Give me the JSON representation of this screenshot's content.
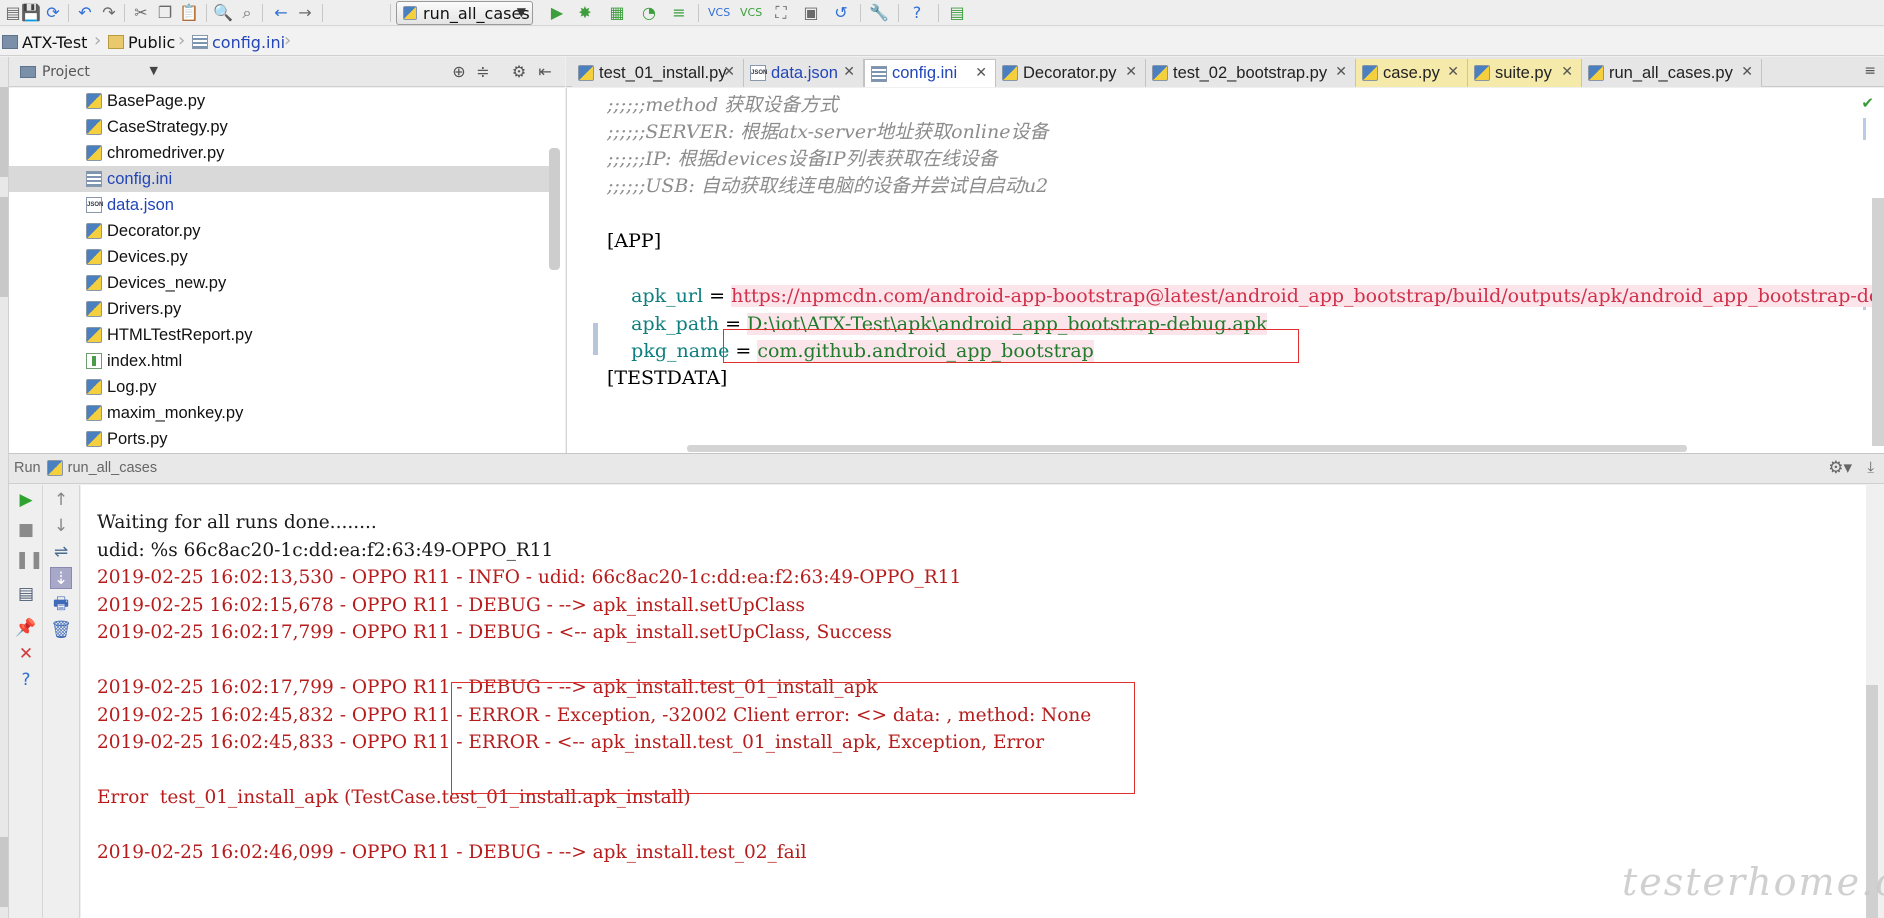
{
  "toolbar": {
    "run_config": "run_all_cases"
  },
  "breadcrumb": {
    "items": [
      "ATX-Test",
      "Public",
      "config.ini"
    ]
  },
  "project": {
    "selector_label": "Project",
    "files": [
      {
        "name": "BasePage.py",
        "type": "py"
      },
      {
        "name": "CaseStrategy.py",
        "type": "py"
      },
      {
        "name": "chromedriver.py",
        "type": "py"
      },
      {
        "name": "config.ini",
        "type": "ini",
        "selected": true
      },
      {
        "name": "data.json",
        "type": "json"
      },
      {
        "name": "Decorator.py",
        "type": "py"
      },
      {
        "name": "Devices.py",
        "type": "py"
      },
      {
        "name": "Devices_new.py",
        "type": "py"
      },
      {
        "name": "Drivers.py",
        "type": "py"
      },
      {
        "name": "HTMLTestReport.py",
        "type": "py"
      },
      {
        "name": "index.html",
        "type": "html"
      },
      {
        "name": "Log.py",
        "type": "py"
      },
      {
        "name": "maxim_monkey.py",
        "type": "py"
      },
      {
        "name": "Ports.py",
        "type": "py"
      }
    ]
  },
  "editor": {
    "tabs": [
      {
        "label": "test_01_install.py"
      },
      {
        "label": "data.json"
      },
      {
        "label": "config.ini"
      },
      {
        "label": "Decorator.py"
      },
      {
        "label": "test_02_bootstrap.py"
      },
      {
        "label": "case.py"
      },
      {
        "label": "suite.py"
      },
      {
        "label": "run_all_cases.py"
      }
    ],
    "lines": [
      {
        "comment": ";;;;;;method 获取设备方式"
      },
      {
        "comment": ";;;;;;SERVER: 根据atx-server地址获取online设备"
      },
      {
        "comment": ";;;;;;IP: 根据devices设备IP列表获取在线设备"
      },
      {
        "comment": ";;;;;;USB: 自动获取线连电脑的设备并尝试自启动u2"
      },
      {
        "comment": ""
      },
      {
        "section": "[APP]"
      },
      {
        "key": "apk_url",
        "eq": " = ",
        "value": "https://npmcdn.com/android-app-bootstrap@latest/android_app_bootstrap/build/outputs/apk/android_app_bootstrap-debug.apk"
      },
      {
        "key": "apk_path",
        "eq": " = ",
        "value": "D:\\iot\\ATX-Test\\apk\\android_app_bootstrap-debug.apk"
      },
      {
        "key": "pkg_name",
        "eq": " = ",
        "value": "com.github.android_app_bootstrap"
      },
      {
        "comment": ""
      },
      {
        "section": "[TESTDATA]"
      }
    ]
  },
  "run": {
    "title_prefix": "Run",
    "config_name": "run_all_cases",
    "console_lines": [
      {
        "text": "Waiting for all runs done........",
        "kind": "plain"
      },
      {
        "text": "udid: %s 66c8ac20-1c:dd:ea:f2:63:49-OPPO_R11",
        "kind": "plain"
      },
      {
        "text": "2019-02-25 16:02:13,530 - OPPO R11 - INFO - udid: 66c8ac20-1c:dd:ea:f2:63:49-OPPO_R11",
        "kind": "err"
      },
      {
        "text": "2019-02-25 16:02:15,678 - OPPO R11 - DEBUG - --> apk_install.setUpClass",
        "kind": "err"
      },
      {
        "text": "2019-02-25 16:02:17,799 - OPPO R11 - DEBUG - <-- apk_install.setUpClass, Success",
        "kind": "err"
      },
      {
        "text": "",
        "kind": "plain"
      },
      {
        "text": "2019-02-25 16:02:17,799 - OPPO R11 - DEBUG - --> apk_install.test_01_install_apk",
        "kind": "err"
      },
      {
        "text": "2019-02-25 16:02:45,832 - OPPO R11 - ERROR - Exception, -32002 Client error: <> data: , method: None",
        "kind": "err"
      },
      {
        "text": "2019-02-25 16:02:45,833 - OPPO R11 - ERROR - <-- apk_install.test_01_install_apk, Exception, Error",
        "kind": "err"
      },
      {
        "text": "",
        "kind": "plain"
      },
      {
        "text": "Error  test_01_install_apk (TestCase.test_01_install.apk_install)",
        "kind": "err"
      },
      {
        "text": "",
        "kind": "plain"
      },
      {
        "text": "2019-02-25 16:02:46,099 - OPPO R11 - DEBUG - --> apk_install.test_02_fail",
        "kind": "err"
      }
    ]
  },
  "watermark": "testerhome.com",
  "colors": {
    "console_error": "#b71c1c",
    "highlight_box": "#e0302c",
    "selected_row": "#d9d9d9"
  }
}
